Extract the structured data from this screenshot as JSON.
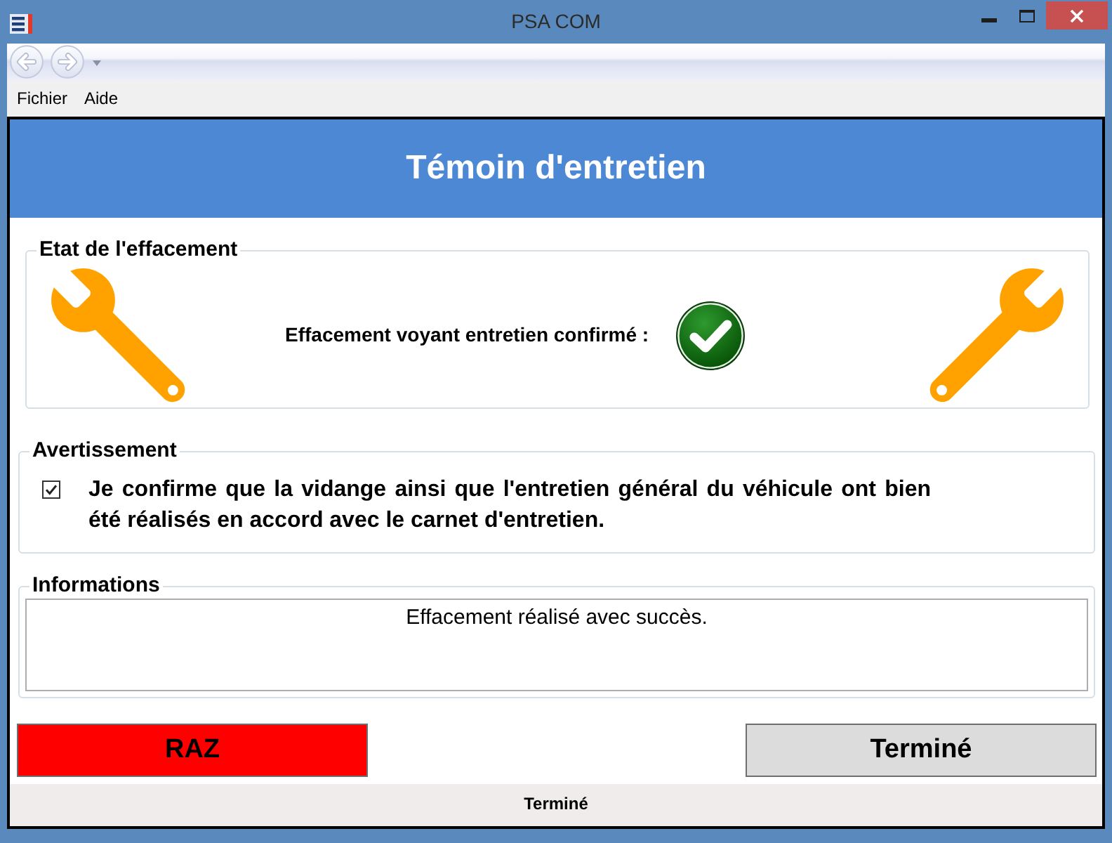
{
  "window": {
    "title": "PSA COM"
  },
  "navigation": [
    {
      "kind": "back",
      "disabled": true
    },
    {
      "kind": "forward",
      "disabled": true
    }
  ],
  "menu": [
    {
      "label": "Fichier"
    },
    {
      "label": "Aide"
    }
  ],
  "header": {
    "title": "Témoin d'entretien"
  },
  "erase_status": {
    "legend": "Etat de l'effacement",
    "message": "Effacement voyant entretien confirmé :",
    "confirmed": true
  },
  "warning": {
    "legend": "Avertissement",
    "checked": true,
    "text": "Je confirme que la vidange ainsi que l'entretien général du véhicule ont bien été réalisés en accord avec le carnet d'entretien."
  },
  "information": {
    "legend": "Informations",
    "text": "Effacement réalisé avec succès."
  },
  "buttons": [
    {
      "label": "RAZ",
      "kind": "reset"
    },
    {
      "label": "Terminé",
      "kind": "finish"
    }
  ],
  "status_bar": {
    "text": "Terminé"
  }
}
